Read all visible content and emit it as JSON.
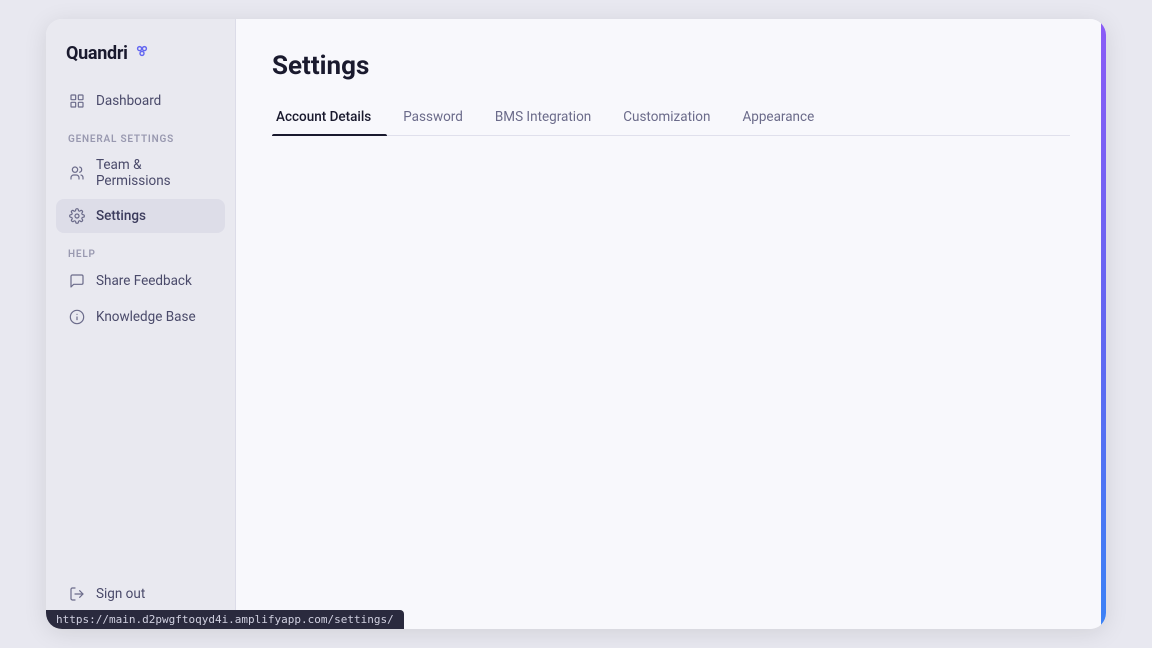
{
  "app": {
    "name": "Quandri",
    "logo_icon": "⁙"
  },
  "sidebar": {
    "dashboard_label": "Dashboard",
    "section_general": "GENERAL SETTINGS",
    "section_help": "HELP",
    "items_general": [
      {
        "id": "team-permissions",
        "label": "Team & Permissions",
        "active": false
      },
      {
        "id": "settings",
        "label": "Settings",
        "active": true
      }
    ],
    "items_help": [
      {
        "id": "share-feedback",
        "label": "Share Feedback",
        "active": false
      },
      {
        "id": "knowledge-base",
        "label": "Knowledge Base",
        "active": false
      }
    ],
    "sign_out_label": "Sign out"
  },
  "main": {
    "page_title": "Settings",
    "tabs": [
      {
        "id": "account-details",
        "label": "Account Details",
        "active": true
      },
      {
        "id": "password",
        "label": "Password",
        "active": false
      },
      {
        "id": "bms-integration",
        "label": "BMS Integration",
        "active": false
      },
      {
        "id": "customization",
        "label": "Customization",
        "active": false
      },
      {
        "id": "appearance",
        "label": "Appearance",
        "active": false
      }
    ]
  },
  "url_bar": {
    "url": "https://main.d2pwgftoqyd4i.amplifyapp.com/settings/"
  }
}
